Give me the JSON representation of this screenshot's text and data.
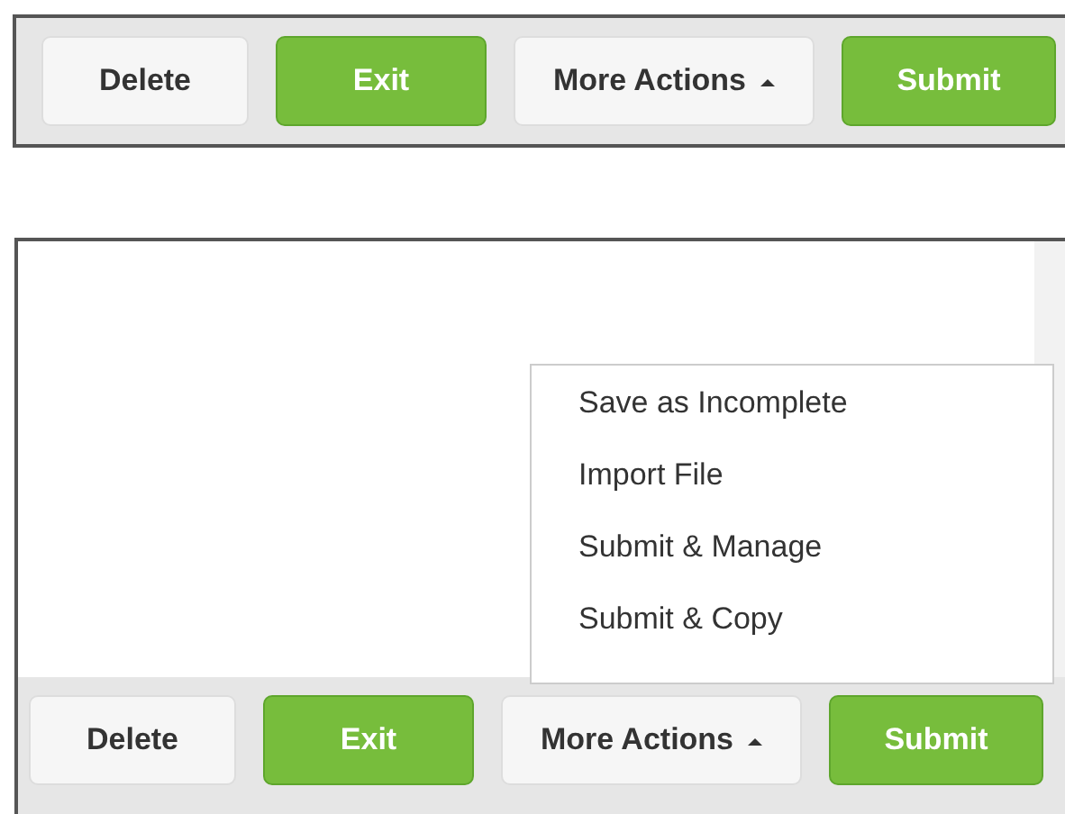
{
  "top_toolbar": {
    "buttons": [
      {
        "label": "Delete",
        "kind": "default",
        "caret": false
      },
      {
        "label": "Exit",
        "kind": "primary",
        "caret": false
      },
      {
        "label": "More Actions",
        "kind": "default",
        "caret": true
      },
      {
        "label": "Submit",
        "kind": "primary",
        "caret": false
      }
    ]
  },
  "bottom_panel": {
    "menu": {
      "items": [
        "Save as Incomplete",
        "Import File",
        "Submit & Manage",
        "Submit & Copy"
      ]
    },
    "buttons": [
      {
        "label": "Delete",
        "kind": "default",
        "caret": false
      },
      {
        "label": "Exit",
        "kind": "primary",
        "caret": false
      },
      {
        "label": "More Actions",
        "kind": "default",
        "caret": true
      },
      {
        "label": "Submit",
        "kind": "primary",
        "caret": false
      }
    ]
  }
}
